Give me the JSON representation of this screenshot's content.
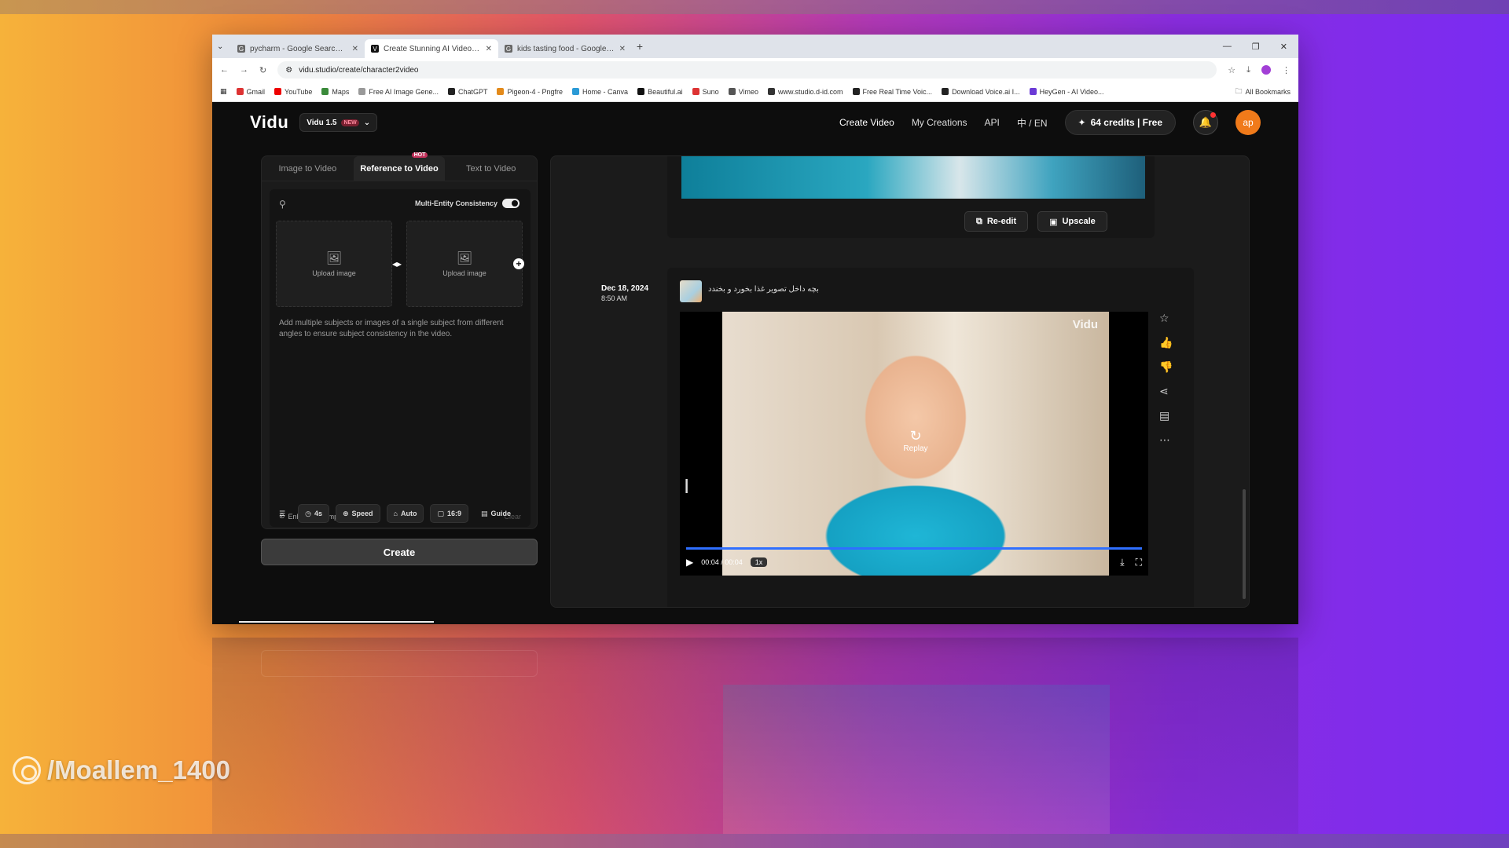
{
  "browser": {
    "tabs": [
      {
        "title": "pycharm - Google Search دانلود",
        "active": false
      },
      {
        "title": "Create Stunning AI Videos in Se",
        "active": true
      },
      {
        "title": "kids tasting food - Google Sear",
        "active": false
      }
    ],
    "url": "vidu.studio/create/character2video",
    "bookmarks": [
      "Gmail",
      "YouTube",
      "Maps",
      "Free AI Image Gene...",
      "ChatGPT",
      "Pigeon-4 - Pngfre",
      "Home - Canva",
      "Beautiful.ai",
      "Suno",
      "Vimeo",
      "www.studio.d-id.com",
      "Free Real Time Voic...",
      "Download Voice.ai I...",
      "HeyGen - AI Video..."
    ],
    "all_bookmarks": "All Bookmarks"
  },
  "app": {
    "logo": "Vidu",
    "model": "Vidu 1.5",
    "model_badge": "NEW",
    "nav": {
      "create_video": "Create Video",
      "my_creations": "My Creations",
      "api": "API",
      "lang": "中 / EN"
    },
    "credits": "64 credits | Free",
    "avatar": "ap"
  },
  "left": {
    "tabs": [
      "Image to Video",
      "Reference to Video",
      "Text to Video"
    ],
    "hot_badge": "HOT",
    "multi_entity": "Multi-Entity Consistency",
    "upload1": "Upload image",
    "upload2": "Upload image",
    "hint": "Add multiple subjects or images of a single subject from different angles to ensure subject consistency in the video.",
    "enhance": "Enhance prompt",
    "clear": "Clear",
    "options": {
      "duration": "4s",
      "speed": "Speed",
      "auto": "Auto",
      "ratio": "16:9",
      "guide": "Guide"
    },
    "create": "Create"
  },
  "right": {
    "reedit": "Re-edit",
    "upscale": "Upscale",
    "date": "Dec 18, 2024",
    "time": "8:50 AM",
    "prompt": "بچه داخل تصویر غذا بخورد و بخندد",
    "watermark": "Vidu",
    "replay": "Replay",
    "timecode": "00:04 / 00:04",
    "speed": "1x",
    "progress": 1.0
  },
  "overlay": {
    "watermark": "/Moallem_1400"
  }
}
